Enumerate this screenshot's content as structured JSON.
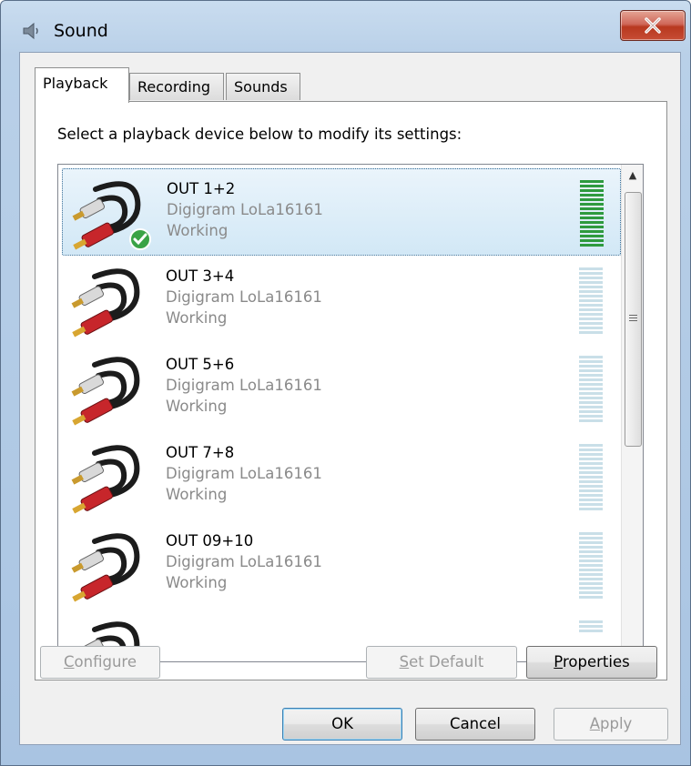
{
  "window": {
    "title": "Sound",
    "icon": "speaker-icon"
  },
  "tabs": [
    {
      "label": "Playback",
      "active": true
    },
    {
      "label": "Recording",
      "active": false
    },
    {
      "label": "Sounds",
      "active": false
    }
  ],
  "instruction": "Select a playback device below to modify its settings:",
  "devices": [
    {
      "name": "OUT 1+2",
      "device": "Digigram LoLa16161",
      "status": "Working",
      "selected": true,
      "default": true,
      "level": 1.0
    },
    {
      "name": "OUT 3+4",
      "device": "Digigram LoLa16161",
      "status": "Working",
      "selected": false,
      "default": false,
      "level": 0
    },
    {
      "name": "OUT 5+6",
      "device": "Digigram LoLa16161",
      "status": "Working",
      "selected": false,
      "default": false,
      "level": 0
    },
    {
      "name": "OUT 7+8",
      "device": "Digigram LoLa16161",
      "status": "Working",
      "selected": false,
      "default": false,
      "level": 0
    },
    {
      "name": "OUT 09+10",
      "device": "Digigram LoLa16161",
      "status": "Working",
      "selected": false,
      "default": false,
      "level": 0
    }
  ],
  "buttons": {
    "configure": {
      "prefix": "",
      "mnemonic": "C",
      "rest": "onfigure",
      "enabled": false
    },
    "set_default": {
      "prefix": "",
      "mnemonic": "S",
      "rest": "et Default",
      "enabled": false
    },
    "properties": {
      "prefix": "",
      "mnemonic": "P",
      "rest": "roperties",
      "enabled": true
    },
    "ok": {
      "label": "OK"
    },
    "cancel": {
      "label": "Cancel"
    },
    "apply": {
      "prefix": "",
      "mnemonic": "A",
      "rest": "pply",
      "enabled": false
    }
  },
  "colors": {
    "meter_active": "#2e9a3e",
    "meter_idle": "#c9dfe8",
    "selection": "#d2e8f6"
  }
}
